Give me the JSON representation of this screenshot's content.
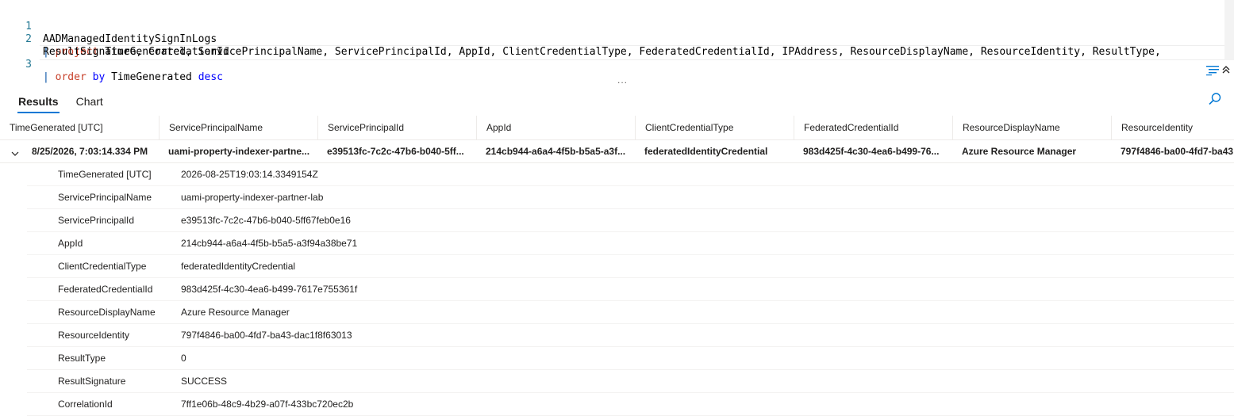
{
  "editor": {
    "lines": [
      {
        "num": "1",
        "text": "AADManagedIdentitySignInLogs"
      },
      {
        "num": "2",
        "pipe": "|",
        "kw": "project",
        "text": "TimeGenerated, ServicePrincipalName, ServicePrincipalId, AppId, ClientCredentialType, FederatedCredentialId, IPAddress, ResourceDisplayName, ResourceIdentity, ResultType,",
        "wrap": "ResultSignature, CorrelationId"
      },
      {
        "num": "3",
        "pipe": "|",
        "kw1": "order",
        "kw2": "by",
        "text": "TimeGenerated",
        "kw3": "desc"
      }
    ],
    "splitter_dots": "..."
  },
  "tabs": [
    {
      "label": "Results",
      "active": true
    },
    {
      "label": "Chart",
      "active": false
    }
  ],
  "grid": {
    "columns": [
      "TimeGenerated [UTC]",
      "ServicePrincipalName",
      "ServicePrincipalId",
      "AppId",
      "ClientCredentialType",
      "FederatedCredentialId",
      "ResourceDisplayName",
      "ResourceIdentity"
    ],
    "row": [
      "8/25/2026, 7:03:14.334 PM",
      "uami-property-indexer-partne...",
      "e39513fc-7c2c-47b6-b040-5ff...",
      "214cb944-a6a4-4f5b-b5a5-a3f...",
      "federatedIdentityCredential",
      "983d425f-4c30-4ea6-b499-76...",
      "Azure Resource Manager",
      "797f4846-ba00-4fd7-ba43"
    ],
    "details": [
      {
        "key": "TimeGenerated [UTC]",
        "value": "2026-08-25T19:03:14.3349154Z"
      },
      {
        "key": "ServicePrincipalName",
        "value": "uami-property-indexer-partner-lab"
      },
      {
        "key": "ServicePrincipalId",
        "value": "e39513fc-7c2c-47b6-b040-5ff67feb0e16"
      },
      {
        "key": "AppId",
        "value": "214cb944-a6a4-4f5b-b5a5-a3f94a38be71"
      },
      {
        "key": "ClientCredentialType",
        "value": "federatedIdentityCredential"
      },
      {
        "key": "FederatedCredentialId",
        "value": "983d425f-4c30-4ea6-b499-7617e755361f"
      },
      {
        "key": "ResourceDisplayName",
        "value": "Azure Resource Manager"
      },
      {
        "key": "ResourceIdentity",
        "value": "797f4846-ba00-4fd7-ba43-dac1f8f63013"
      },
      {
        "key": "ResultType",
        "value": "0"
      },
      {
        "key": "ResultSignature",
        "value": "SUCCESS"
      },
      {
        "key": "CorrelationId",
        "value": "7ff1e06b-48c9-4b29-a07f-433bc720ec2b"
      }
    ]
  },
  "icons": {
    "format": "format-query-icon",
    "collapse": "collapse-editor-icon",
    "search": "search-icon",
    "chevron": "chevron-down-icon"
  },
  "colors": {
    "accent": "#0078d4",
    "keyword": "#c7402a",
    "keyword_blue": "#0000ff",
    "line_number": "#237893"
  }
}
